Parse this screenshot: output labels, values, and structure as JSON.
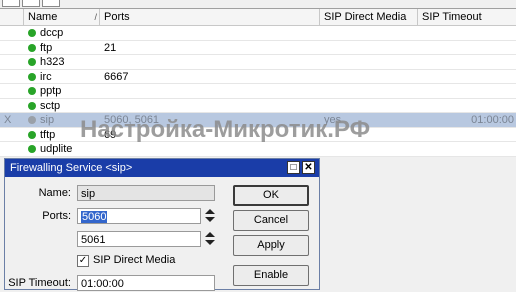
{
  "table": {
    "columns": [
      "",
      "Name",
      "Ports",
      "SIP Direct Media",
      "SIP Timeout"
    ],
    "rows": [
      {
        "flag": "",
        "name": "dccp",
        "ports": "",
        "direct": "",
        "timeout": ""
      },
      {
        "flag": "",
        "name": "ftp",
        "ports": "21",
        "direct": "",
        "timeout": ""
      },
      {
        "flag": "",
        "name": "h323",
        "ports": "",
        "direct": "",
        "timeout": ""
      },
      {
        "flag": "",
        "name": "irc",
        "ports": "6667",
        "direct": "",
        "timeout": ""
      },
      {
        "flag": "",
        "name": "pptp",
        "ports": "",
        "direct": "",
        "timeout": ""
      },
      {
        "flag": "",
        "name": "sctp",
        "ports": "",
        "direct": "",
        "timeout": ""
      },
      {
        "flag": "X",
        "name": "sip",
        "ports": "5060, 5061",
        "direct": "yes",
        "timeout": "01:00:00"
      },
      {
        "flag": "",
        "name": "tftp",
        "ports": "69",
        "direct": "",
        "timeout": ""
      },
      {
        "flag": "",
        "name": "udplite",
        "ports": "",
        "direct": "",
        "timeout": ""
      }
    ],
    "selected_row": 6
  },
  "watermark": "Настройка-Микротик.РФ",
  "dialog": {
    "title": "Firewalling Service <sip>",
    "name_label": "Name:",
    "name_value": "sip",
    "ports_label": "Ports:",
    "port1": "5060",
    "port2": "5061",
    "direct_media_label": "SIP Direct Media",
    "direct_media_checked": true,
    "check_glyph": "✓",
    "timeout_label": "SIP Timeout:",
    "timeout_value": "01:00:00",
    "buttons": {
      "ok": "OK",
      "cancel": "Cancel",
      "apply": "Apply",
      "enable": "Enable"
    }
  },
  "icons": {
    "status": "status-dot-icon",
    "sort": "sort-indicator-icon",
    "spin": "spinner-arrows-icon"
  },
  "colors": {
    "enabled_dot": "#28a428",
    "selection": "#b8c8e0",
    "title_bar": "#1a3da8"
  }
}
